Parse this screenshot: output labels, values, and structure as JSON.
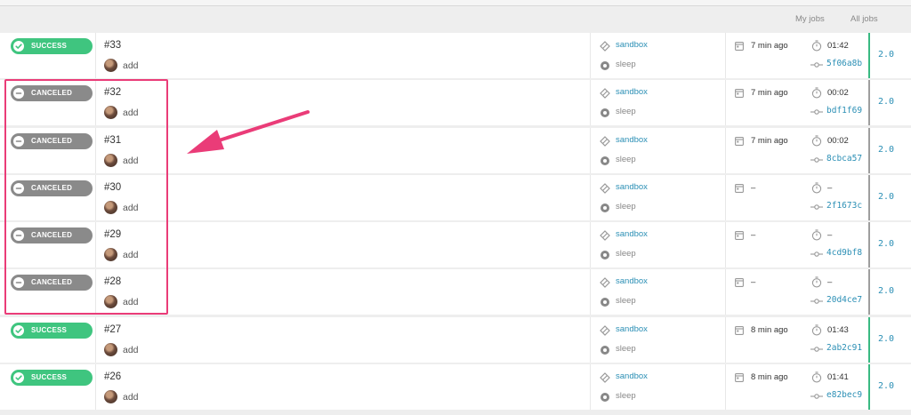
{
  "header": {
    "tabs": [
      "My jobs",
      "All jobs"
    ]
  },
  "jobs": [
    {
      "status": "SUCCESS",
      "number": "#33",
      "commit": "add",
      "env": "sandbox",
      "stage": "sleep",
      "ago": "7 min ago",
      "duration": "01:42",
      "sha": "5f06a8b",
      "version": "2.0"
    },
    {
      "status": "CANCELED",
      "number": "#32",
      "commit": "add",
      "env": "sandbox",
      "stage": "sleep",
      "ago": "7 min ago",
      "duration": "00:02",
      "sha": "bdf1f69",
      "version": "2.0"
    },
    {
      "status": "CANCELED",
      "number": "#31",
      "commit": "add",
      "env": "sandbox",
      "stage": "sleep",
      "ago": "7 min ago",
      "duration": "00:02",
      "sha": "8cbca57",
      "version": "2.0"
    },
    {
      "status": "CANCELED",
      "number": "#30",
      "commit": "add",
      "env": "sandbox",
      "stage": "sleep",
      "ago": "–",
      "duration": "–",
      "sha": "2f1673c",
      "version": "2.0"
    },
    {
      "status": "CANCELED",
      "number": "#29",
      "commit": "add",
      "env": "sandbox",
      "stage": "sleep",
      "ago": "–",
      "duration": "–",
      "sha": "4cd9bf8",
      "version": "2.0"
    },
    {
      "status": "CANCELED",
      "number": "#28",
      "commit": "add",
      "env": "sandbox",
      "stage": "sleep",
      "ago": "–",
      "duration": "–",
      "sha": "20d4ce7",
      "version": "2.0"
    },
    {
      "status": "SUCCESS",
      "number": "#27",
      "commit": "add",
      "env": "sandbox",
      "stage": "sleep",
      "ago": "8 min ago",
      "duration": "01:43",
      "sha": "2ab2c91",
      "version": "2.0"
    },
    {
      "status": "SUCCESS",
      "number": "#26",
      "commit": "add",
      "env": "sandbox",
      "stage": "sleep",
      "ago": "8 min ago",
      "duration": "01:41",
      "sha": "e82bec9",
      "version": "2.0"
    }
  ],
  "colors": {
    "success": "#3fc57f",
    "canceled": "#8a8a8a",
    "link": "#2b8fb5",
    "annotation": "#ea3c78"
  },
  "icons": {
    "status_success": "check-circle-icon",
    "status_canceled": "minus-circle-icon",
    "environment": "environment-icon",
    "stage": "stage-dot-icon",
    "created": "calendar-icon",
    "duration": "timer-icon",
    "commit": "commit-icon"
  }
}
